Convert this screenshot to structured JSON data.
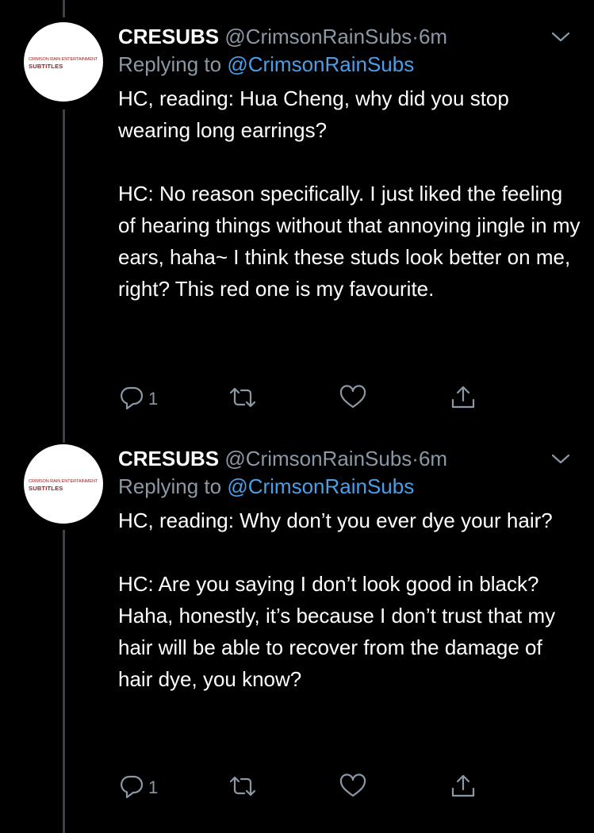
{
  "tweets": [
    {
      "avatar": {
        "line1": "CRIMSON RAIN ENTERTAINMENT",
        "line2": "SUBTITLES"
      },
      "name": "CRESUBS",
      "handle": "@CrimsonRainSubs",
      "dot": "·",
      "time": "6m",
      "replying_prefix": "Replying to",
      "replying_mention": "@CrimsonRainSubs",
      "paragraphs": [
        "HC, reading: Hua Cheng, why did you stop wearing long earrings?",
        "HC: No reason specifically. I just liked the feeling of hearing things without that annoying jingle in my ears, haha~ I think these studs look better on me, right? This red one is my favourite."
      ],
      "reply_count": "1",
      "icons": {
        "reply": "reply-icon",
        "retweet": "retweet-icon",
        "like": "heart-icon",
        "share": "share-icon",
        "more": "chevron-down-icon"
      }
    },
    {
      "avatar": {
        "line1": "CRIMSON RAIN ENTERTAINMENT",
        "line2": "SUBTITLES"
      },
      "name": "CRESUBS",
      "handle": "@CrimsonRainSubs",
      "dot": "·",
      "time": "6m",
      "replying_prefix": "Replying to",
      "replying_mention": "@CrimsonRainSubs",
      "paragraphs": [
        "HC, reading: Why don’t you ever dye your hair?",
        "HC: Are you saying I don’t look good in black? Haha, honestly, it’s because I don’t trust that my hair will be able to recover from  the damage of hair dye, you know?"
      ],
      "reply_count": "1",
      "icons": {
        "reply": "reply-icon",
        "retweet": "retweet-icon",
        "like": "heart-icon",
        "share": "share-icon",
        "more": "chevron-down-icon"
      }
    }
  ],
  "colors": {
    "background": "#000000",
    "text": "#ffffff",
    "secondary": "#8b98a5",
    "link": "#4a9fea",
    "thread_line": "#3d4248",
    "logo_red": "#9a1a1a"
  }
}
